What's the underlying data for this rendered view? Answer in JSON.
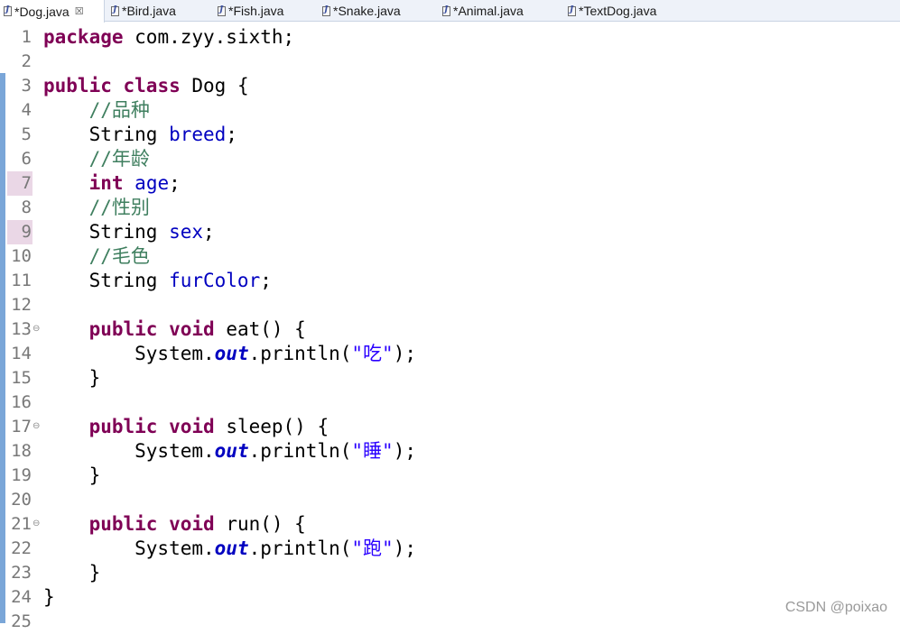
{
  "tabs": [
    {
      "label": "*Dog.java",
      "active": true
    },
    {
      "label": "*Bird.java",
      "active": false
    },
    {
      "label": "*Fish.java",
      "active": false
    },
    {
      "label": "*Snake.java",
      "active": false
    },
    {
      "label": "*Animal.java",
      "active": false
    },
    {
      "label": "*TextDog.java",
      "active": false
    }
  ],
  "tab_close_glyph": "☒",
  "icons": {
    "file": "java-file-icon",
    "close": "close-icon",
    "fold": "collapse-icon"
  },
  "colors": {
    "keyword": "#7f0055",
    "field": "#0000c0",
    "comment": "#3f7f5f",
    "string": "#2a00ff",
    "line_number": "#787878",
    "highlight": "#ead7e6"
  },
  "editor": {
    "lines": [
      {
        "n": "1",
        "tokens": [
          {
            "t": "kw",
            "v": "package"
          },
          {
            "t": "plain",
            "v": " com.zyy.sixth;"
          }
        ]
      },
      {
        "n": "2",
        "tokens": []
      },
      {
        "n": "3",
        "tokens": [
          {
            "t": "kw",
            "v": "public"
          },
          {
            "t": "plain",
            "v": " "
          },
          {
            "t": "kw",
            "v": "class"
          },
          {
            "t": "plain",
            "v": " Dog {"
          }
        ]
      },
      {
        "n": "4",
        "tokens": [
          {
            "t": "plain",
            "v": "    "
          },
          {
            "t": "cmt",
            "v": "//品种"
          }
        ]
      },
      {
        "n": "5",
        "tokens": [
          {
            "t": "plain",
            "v": "    String "
          },
          {
            "t": "fld",
            "v": "breed"
          },
          {
            "t": "plain",
            "v": ";"
          }
        ]
      },
      {
        "n": "6",
        "tokens": [
          {
            "t": "plain",
            "v": "    "
          },
          {
            "t": "cmt",
            "v": "//年龄"
          }
        ]
      },
      {
        "n": "7",
        "tokens": [
          {
            "t": "plain",
            "v": "    "
          },
          {
            "t": "kw",
            "v": "int"
          },
          {
            "t": "plain",
            "v": " "
          },
          {
            "t": "fld",
            "v": "age"
          },
          {
            "t": "plain",
            "v": ";"
          }
        ]
      },
      {
        "n": "8",
        "tokens": [
          {
            "t": "plain",
            "v": "    "
          },
          {
            "t": "cmt",
            "v": "//性别"
          }
        ]
      },
      {
        "n": "9",
        "tokens": [
          {
            "t": "plain",
            "v": "    String "
          },
          {
            "t": "fld",
            "v": "sex"
          },
          {
            "t": "plain",
            "v": ";"
          }
        ]
      },
      {
        "n": "10",
        "tokens": [
          {
            "t": "plain",
            "v": "    "
          },
          {
            "t": "cmt",
            "v": "//毛色"
          }
        ]
      },
      {
        "n": "11",
        "tokens": [
          {
            "t": "plain",
            "v": "    String "
          },
          {
            "t": "fld",
            "v": "furColor"
          },
          {
            "t": "plain",
            "v": ";"
          }
        ]
      },
      {
        "n": "12",
        "tokens": []
      },
      {
        "n": "13",
        "tokens": [
          {
            "t": "plain",
            "v": "    "
          },
          {
            "t": "kw",
            "v": "public"
          },
          {
            "t": "plain",
            "v": " "
          },
          {
            "t": "kw",
            "v": "void"
          },
          {
            "t": "plain",
            "v": " eat() {"
          }
        ]
      },
      {
        "n": "14",
        "tokens": [
          {
            "t": "plain",
            "v": "        System."
          },
          {
            "t": "sfld",
            "v": "out"
          },
          {
            "t": "plain",
            "v": ".println("
          },
          {
            "t": "str",
            "v": "\"吃\""
          },
          {
            "t": "plain",
            "v": ");"
          }
        ]
      },
      {
        "n": "15",
        "tokens": [
          {
            "t": "plain",
            "v": "    }"
          }
        ]
      },
      {
        "n": "16",
        "tokens": []
      },
      {
        "n": "17",
        "tokens": [
          {
            "t": "plain",
            "v": "    "
          },
          {
            "t": "kw",
            "v": "public"
          },
          {
            "t": "plain",
            "v": " "
          },
          {
            "t": "kw",
            "v": "void"
          },
          {
            "t": "plain",
            "v": " sleep() {"
          }
        ]
      },
      {
        "n": "18",
        "tokens": [
          {
            "t": "plain",
            "v": "        System."
          },
          {
            "t": "sfld",
            "v": "out"
          },
          {
            "t": "plain",
            "v": ".println("
          },
          {
            "t": "str",
            "v": "\"睡\""
          },
          {
            "t": "plain",
            "v": ");"
          }
        ]
      },
      {
        "n": "19",
        "tokens": [
          {
            "t": "plain",
            "v": "    }"
          }
        ]
      },
      {
        "n": "20",
        "tokens": []
      },
      {
        "n": "21",
        "tokens": [
          {
            "t": "plain",
            "v": "    "
          },
          {
            "t": "kw",
            "v": "public"
          },
          {
            "t": "plain",
            "v": " "
          },
          {
            "t": "kw",
            "v": "void"
          },
          {
            "t": "plain",
            "v": " run() {"
          }
        ]
      },
      {
        "n": "22",
        "tokens": [
          {
            "t": "plain",
            "v": "        System."
          },
          {
            "t": "sfld",
            "v": "out"
          },
          {
            "t": "plain",
            "v": ".println("
          },
          {
            "t": "str",
            "v": "\"跑\""
          },
          {
            "t": "plain",
            "v": ");"
          }
        ]
      },
      {
        "n": "23",
        "tokens": [
          {
            "t": "plain",
            "v": "    }"
          }
        ]
      },
      {
        "n": "24",
        "tokens": [
          {
            "t": "plain",
            "v": "}"
          }
        ]
      },
      {
        "n": "25",
        "tokens": []
      }
    ],
    "highlighted_lines": [
      "7",
      "9"
    ],
    "folded_lines": [
      "13",
      "17",
      "21"
    ]
  },
  "watermark": "CSDN @poixao"
}
